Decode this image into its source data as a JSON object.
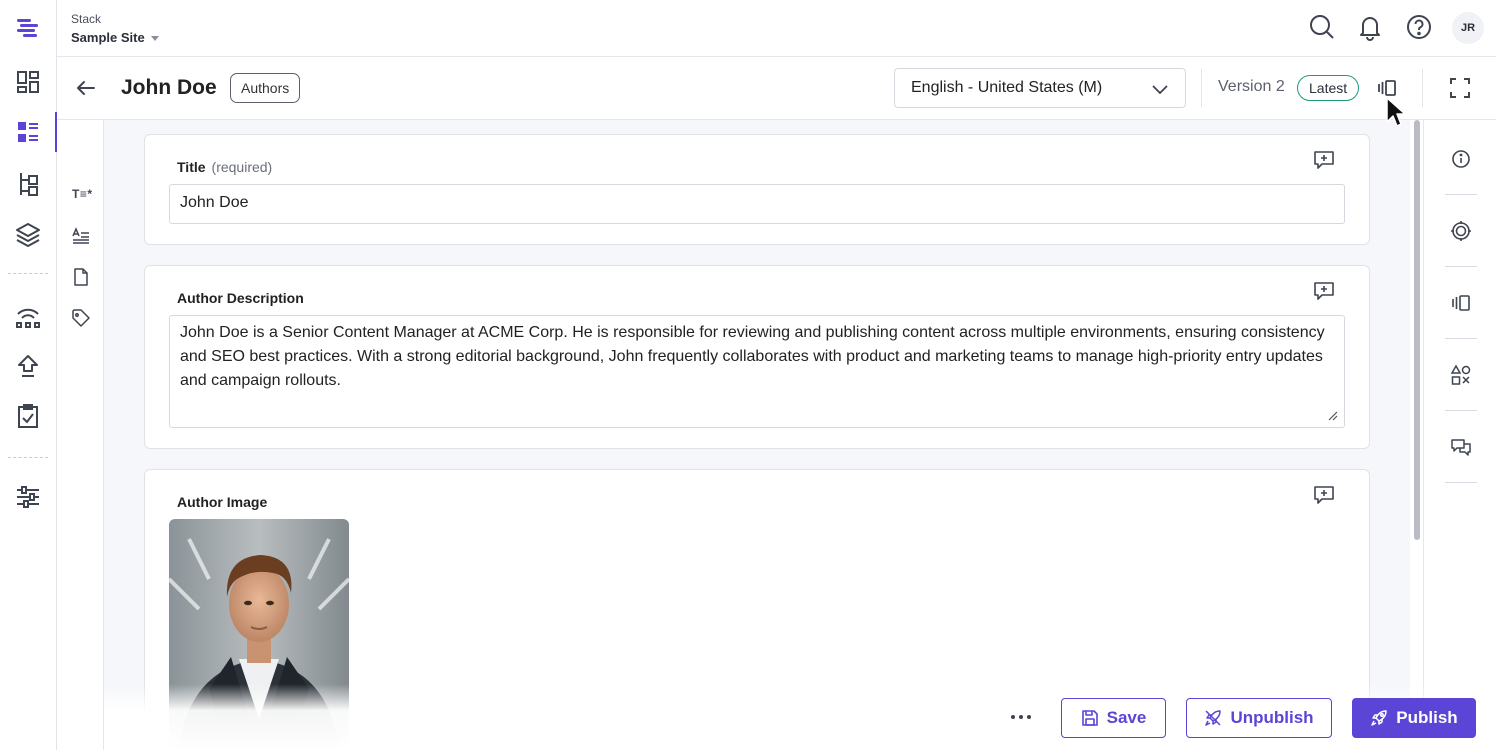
{
  "app": {
    "stack_label": "Stack",
    "site_name": "Sample Site",
    "avatar_initials": "JR",
    "accent_color": "#5a45d6"
  },
  "rail": {
    "items": [
      {
        "name": "dashboard-icon"
      },
      {
        "name": "entries-icon",
        "active": true
      },
      {
        "name": "content-models-icon"
      },
      {
        "name": "assets-icon"
      },
      {
        "name": "releases-icon"
      },
      {
        "name": "publish-queue-icon"
      },
      {
        "name": "workflow-tasks-icon"
      },
      {
        "name": "settings-icon"
      }
    ]
  },
  "topbar": {
    "icons": [
      "search-icon",
      "bell-icon",
      "help-icon"
    ]
  },
  "entry": {
    "title": "John Doe",
    "content_type": "Authors",
    "locale": "English - United States (M)",
    "version_label": "Version 2",
    "version_badge": "Latest"
  },
  "fieldnav": {
    "icons": [
      "title-field-icon",
      "text-field-icon",
      "file-field-icon",
      "tag-field-icon"
    ],
    "title_marker": "T≡*"
  },
  "fields": {
    "title": {
      "label": "Title",
      "required": "(required)",
      "value": "John Doe"
    },
    "description": {
      "label": "Author Description",
      "value": "John Doe is a Senior Content Manager at ACME Corp. He is responsible for reviewing and publishing content across multiple environments, ensuring consistency and SEO best practices. With a strong editorial background, John frequently collaborates with product and marketing teams to manage high-priority entry updates and campaign rollouts."
    },
    "image": {
      "label": "Author Image"
    }
  },
  "right_rail": {
    "icons": [
      "info-icon",
      "target-icon",
      "compare-icon",
      "shapes-icon",
      "comments-icon"
    ]
  },
  "actions": {
    "save": "Save",
    "unpublish": "Unpublish",
    "publish": "Publish"
  }
}
